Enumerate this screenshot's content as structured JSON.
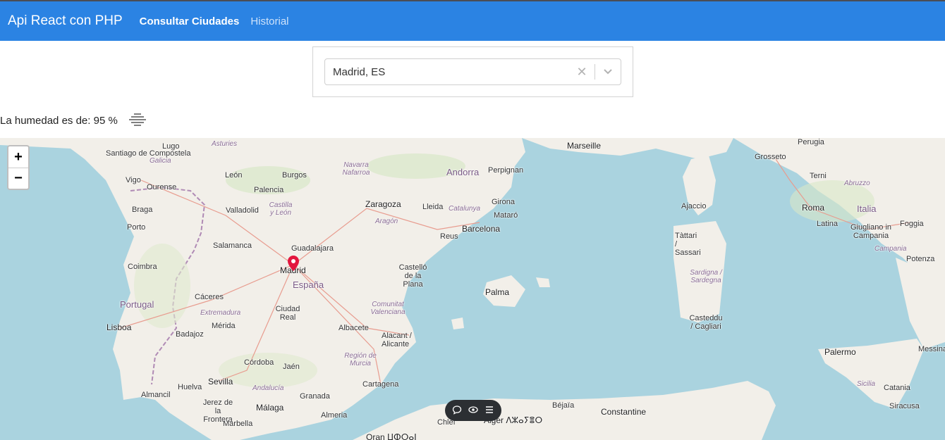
{
  "navbar": {
    "brand": "Api React con PHP",
    "links": [
      "Consultar Ciudades",
      "Historial"
    ]
  },
  "city_select": {
    "value": "Madrid, ES",
    "clear_icon": "close-icon",
    "dropdown_icon": "chevron-down-icon"
  },
  "humidity": {
    "text": "La humedad es de: 95 %",
    "icon": "fog-icon"
  },
  "map": {
    "zoom_in": "+",
    "zoom_out": "−",
    "marker_city": "Madrid",
    "labels": {
      "countries": [
        "Portugal",
        "España",
        "Andorra",
        "Italia"
      ],
      "cities": [
        "Santiago de Compostela",
        "Lugo",
        "Vigo",
        "Ourense",
        "Braga",
        "Porto",
        "León",
        "Burgos",
        "Palencia",
        "Valladolid",
        "Salamanca",
        "Coimbra",
        "Guadalajara",
        "Madrid",
        "Cáceres",
        "Ciudad Real",
        "Lisboa",
        "Badajoz",
        "Mérida",
        "Córdoba",
        "Jaén",
        "Sevilla",
        "Huelva",
        "Almancil",
        "Jerez de la Frontera",
        "Málaga",
        "Granada",
        "Marbella",
        "Almeria",
        "Albacete",
        "Alacant / Alicante",
        "Cartagena",
        "Castelló de la Plana",
        "Zaragoza",
        "Lleida",
        "Reus",
        "Barcelona",
        "Mataró",
        "Girona",
        "Perpignan",
        "Marseille",
        "Palma",
        "Ajaccio",
        "Tàttari / Sassari",
        "Casteddu / Cagliari",
        "Grosseto",
        "Perugia",
        "Terni",
        "Roma",
        "Latina",
        "Giugliano in Campania",
        "Foggia",
        "Potenza",
        "Palermo",
        "Messina",
        "Catania",
        "Siracusa",
        "Béjaïa",
        "Constantine",
        "Chlef",
        "Alger ⴷⵣⴰⵢⴻⵔ",
        "Oran ⵡⵀⵔⴰⵏ"
      ],
      "regions": [
        "Asturies",
        "Galicia",
        "Navarra Nafarroa",
        "Castilla y León",
        "Catalunya",
        "Aragón",
        "Extremadura",
        "Comunitat Valenciana",
        "Región de Murcia",
        "Andalucía",
        "Sardigna / Sardegna",
        "Abruzzo",
        "Campania",
        "Sicilia"
      ]
    },
    "toolbar": [
      "comment-icon",
      "eye-icon",
      "menu-icon"
    ]
  }
}
